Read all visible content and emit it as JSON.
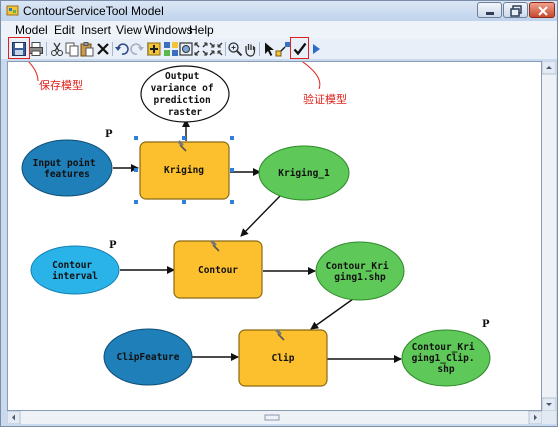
{
  "window": {
    "title": "ContourServiceTool Model"
  },
  "menu": [
    "Model",
    "Edit",
    "Insert",
    "View",
    "Windows",
    "Help"
  ],
  "toolbar": {
    "icons": [
      "save-icon",
      "print-icon",
      "cut-icon",
      "copy-icon",
      "paste-icon",
      "delete-icon",
      "undo-icon",
      "redo-icon",
      "add-data-icon",
      "auto-layout-icon",
      "full-extent-icon",
      "zoom-in-fixed-icon",
      "zoom-out-fixed-icon",
      "zoom-in-icon",
      "pan-icon",
      "select-icon",
      "connect-icon",
      "validate-icon",
      "run-icon"
    ]
  },
  "annotations": {
    "save_model": "保存模型",
    "validate_model": "验证模型"
  },
  "colors": {
    "input_data": "#1f7fb8",
    "input_light": "#29b3e8",
    "tool": "#fcc02e",
    "derived_data": "#5ec858",
    "annotation": "#e0201a"
  },
  "model": {
    "output_variance": [
      "Output",
      "variance of",
      "prediction",
      "raster"
    ],
    "input_point_features": [
      "Input point",
      "features"
    ],
    "kriging_tool": "Kriging",
    "kriging_output": "Kriging_1",
    "contour_interval": [
      "Contour",
      "interval"
    ],
    "contour_tool": "Contour",
    "contour_output": [
      "Contour_Kri",
      "ging1.shp"
    ],
    "clip_feature": "ClipFeature",
    "clip_tool": "Clip",
    "clip_output": [
      "Contour_Kri",
      "ging1_Clip.",
      "shp"
    ],
    "parameter_marker": "P"
  }
}
